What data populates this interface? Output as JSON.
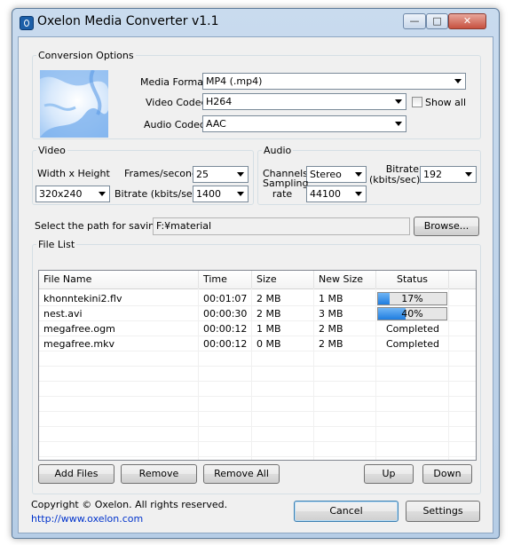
{
  "window": {
    "title": "Oxelon Media Converter v1.1"
  },
  "conversion_options": {
    "group_label": "Conversion Options",
    "media_format_label": "Media Format",
    "media_format_value": "MP4 (.mp4)",
    "video_codec_label": "Video Codec",
    "video_codec_value": "H264",
    "show_all_label": "Show all",
    "audio_codec_label": "Audio Codec",
    "audio_codec_value": "AAC"
  },
  "video": {
    "group_label": "Video",
    "size_label": "Width x Height",
    "size_value": "320x240",
    "fps_label": "Frames/second",
    "fps_value": "25",
    "bitrate_label": "Bitrate (kbits/sec)",
    "bitrate_value": "1400"
  },
  "audio": {
    "group_label": "Audio",
    "channels_label": "Channels",
    "channels_value": "Stereo",
    "bitrate_label_1": "Bitrate",
    "bitrate_label_2": "(kbits/sec)",
    "bitrate_value": "192",
    "sampling_label_1": "Sampling",
    "sampling_label_2": "rate",
    "sampling_value": "44100"
  },
  "save": {
    "label": "Select the path for saving:",
    "path": "F:¥material",
    "browse_label": "Browse..."
  },
  "file_list": {
    "group_label": "File List",
    "columns": [
      "File Name",
      "Time",
      "Size",
      "New Size",
      "Status"
    ],
    "rows": [
      {
        "name": "khonntekini2.flv",
        "time": "00:01:07",
        "size": "2 MB",
        "new_size": "1 MB",
        "status": "17%",
        "progress": 0.17
      },
      {
        "name": "nest.avi",
        "time": "00:00:30",
        "size": "2 MB",
        "new_size": "3 MB",
        "status": "40%",
        "progress": 0.4
      },
      {
        "name": "megafree.ogm",
        "time": "00:00:12",
        "size": "1 MB",
        "new_size": "2 MB",
        "status": "Completed"
      },
      {
        "name": "megafree.mkv",
        "time": "00:00:12",
        "size": "0 MB",
        "new_size": "2 MB",
        "status": "Completed"
      }
    ]
  },
  "buttons": {
    "add_files": "Add Files",
    "remove": "Remove",
    "remove_all": "Remove All",
    "up": "Up",
    "down": "Down",
    "cancel": "Cancel",
    "settings": "Settings"
  },
  "footer": {
    "copyright": "Copyright © Oxelon. All rights reserved.",
    "url": "http://www.oxelon.com"
  },
  "colors": {
    "progress_fill": "#1f7de0",
    "link": "#0033cc"
  }
}
